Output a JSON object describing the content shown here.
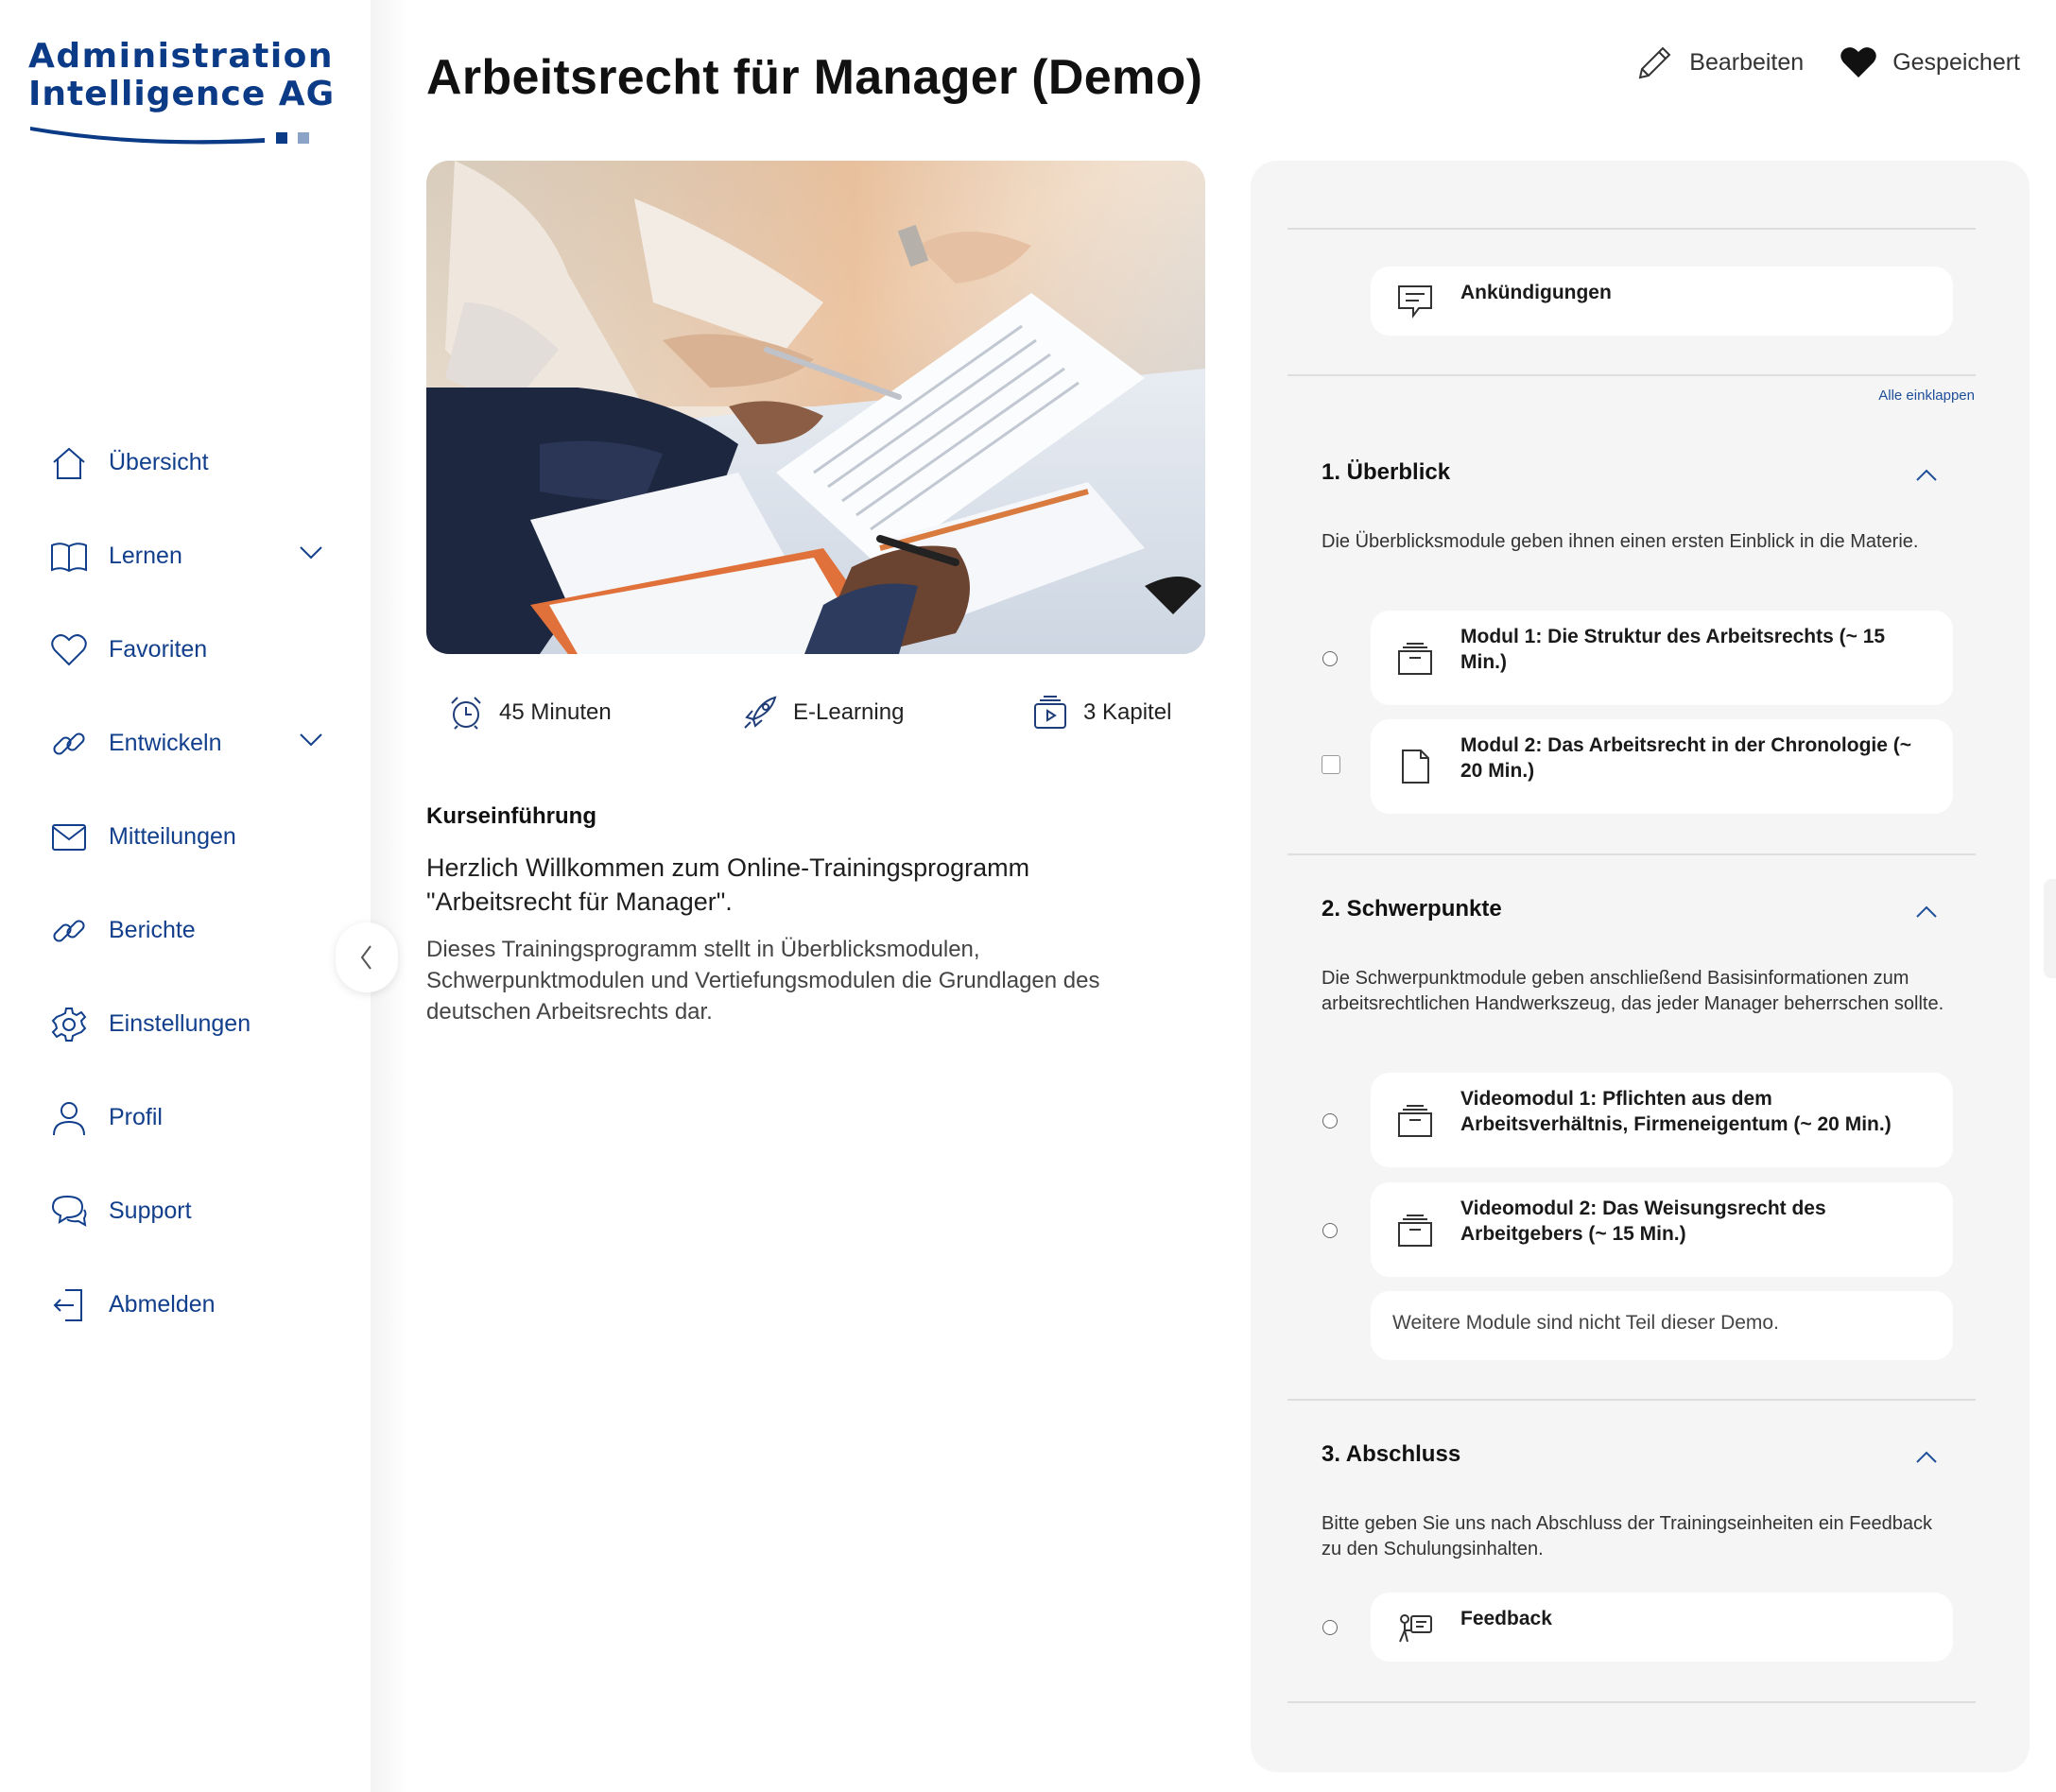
{
  "brand": {
    "line1": "Administration",
    "line2": "Intelligence AG",
    "color": "#0b3a86"
  },
  "sidebar": {
    "items": [
      {
        "label": "Übersicht",
        "icon": "home-icon"
      },
      {
        "label": "Lernen",
        "icon": "book-icon",
        "expandable": true
      },
      {
        "label": "Favoriten",
        "icon": "heart-icon"
      },
      {
        "label": "Entwickeln",
        "icon": "link-icon",
        "expandable": true
      },
      {
        "label": "Mitteilungen",
        "icon": "mail-icon"
      },
      {
        "label": "Berichte",
        "icon": "link-icon"
      },
      {
        "label": "Einstellungen",
        "icon": "gear-icon"
      },
      {
        "label": "Profil",
        "icon": "user-icon"
      },
      {
        "label": "Support",
        "icon": "chat-bubbles-icon"
      },
      {
        "label": "Abmelden",
        "icon": "logout-icon"
      }
    ]
  },
  "header": {
    "title": "Arbeitsrecht für Manager (Demo)",
    "edit_label": "Bearbeiten",
    "saved_label": "Gespeichert"
  },
  "hero": {
    "image": "contract-signing-photo"
  },
  "meta": {
    "duration": "45 Minuten",
    "format": "E-Learning",
    "chapters": "3 Kapitel"
  },
  "intro": {
    "heading": "Kurseinführung",
    "lead": "Herzlich Willkommen zum Online-Trainingsprogramm \"Arbeitsrecht für Manager\".",
    "body": "Dieses Trainingsprogramm stellt in Überblicksmodulen, Schwerpunktmodulen und Vertiefungsmodulen die Grundlagen des deutschen Arbeitsrechts dar."
  },
  "panel": {
    "announcements": "Ankündigungen",
    "collapse_all": "Alle einklappen",
    "sections": [
      {
        "title": "1. Überblick",
        "description": "Die Überblicksmodule geben ihnen einen ersten Einblick in die Materie.",
        "items": [
          {
            "title": "Modul 1: Die Struktur des Arbeitsrechts (~ 15 Min.)",
            "icon": "archive-box-icon",
            "status": "radio"
          },
          {
            "title": "Modul 2: Das Arbeitsrecht in der Chronologie (~ 20 Min.)",
            "icon": "document-icon",
            "status": "checkbox"
          }
        ]
      },
      {
        "title": "2. Schwerpunkte",
        "description": "Die Schwerpunktmodule geben anschließend Basisinformationen zum arbeitsrechtlichen Handwerkszeug, das jeder Manager beherrschen sollte.",
        "items": [
          {
            "title": "Videomodul 1: Pflichten aus dem Arbeitsverhältnis, Firmeneigentum (~ 20 Min.)",
            "icon": "archive-box-icon",
            "status": "radio"
          },
          {
            "title": "Videomodul 2: Das Weisungsrecht des Arbeitgebers (~ 15 Min.)",
            "icon": "archive-box-icon",
            "status": "radio"
          }
        ],
        "note": "Weitere Module sind nicht Teil dieser Demo."
      },
      {
        "title": "3. Abschluss",
        "description": "Bitte geben Sie uns nach Abschluss der Trainingseinheiten ein Feedback zu den Schulungsinhalten.",
        "items": [
          {
            "title": "Feedback",
            "icon": "feedback-icon",
            "status": "radio"
          }
        ]
      }
    ]
  },
  "colors": {
    "accent": "#123f8c",
    "panel_bg": "#f5f5f5",
    "link": "#1f4f9a"
  }
}
